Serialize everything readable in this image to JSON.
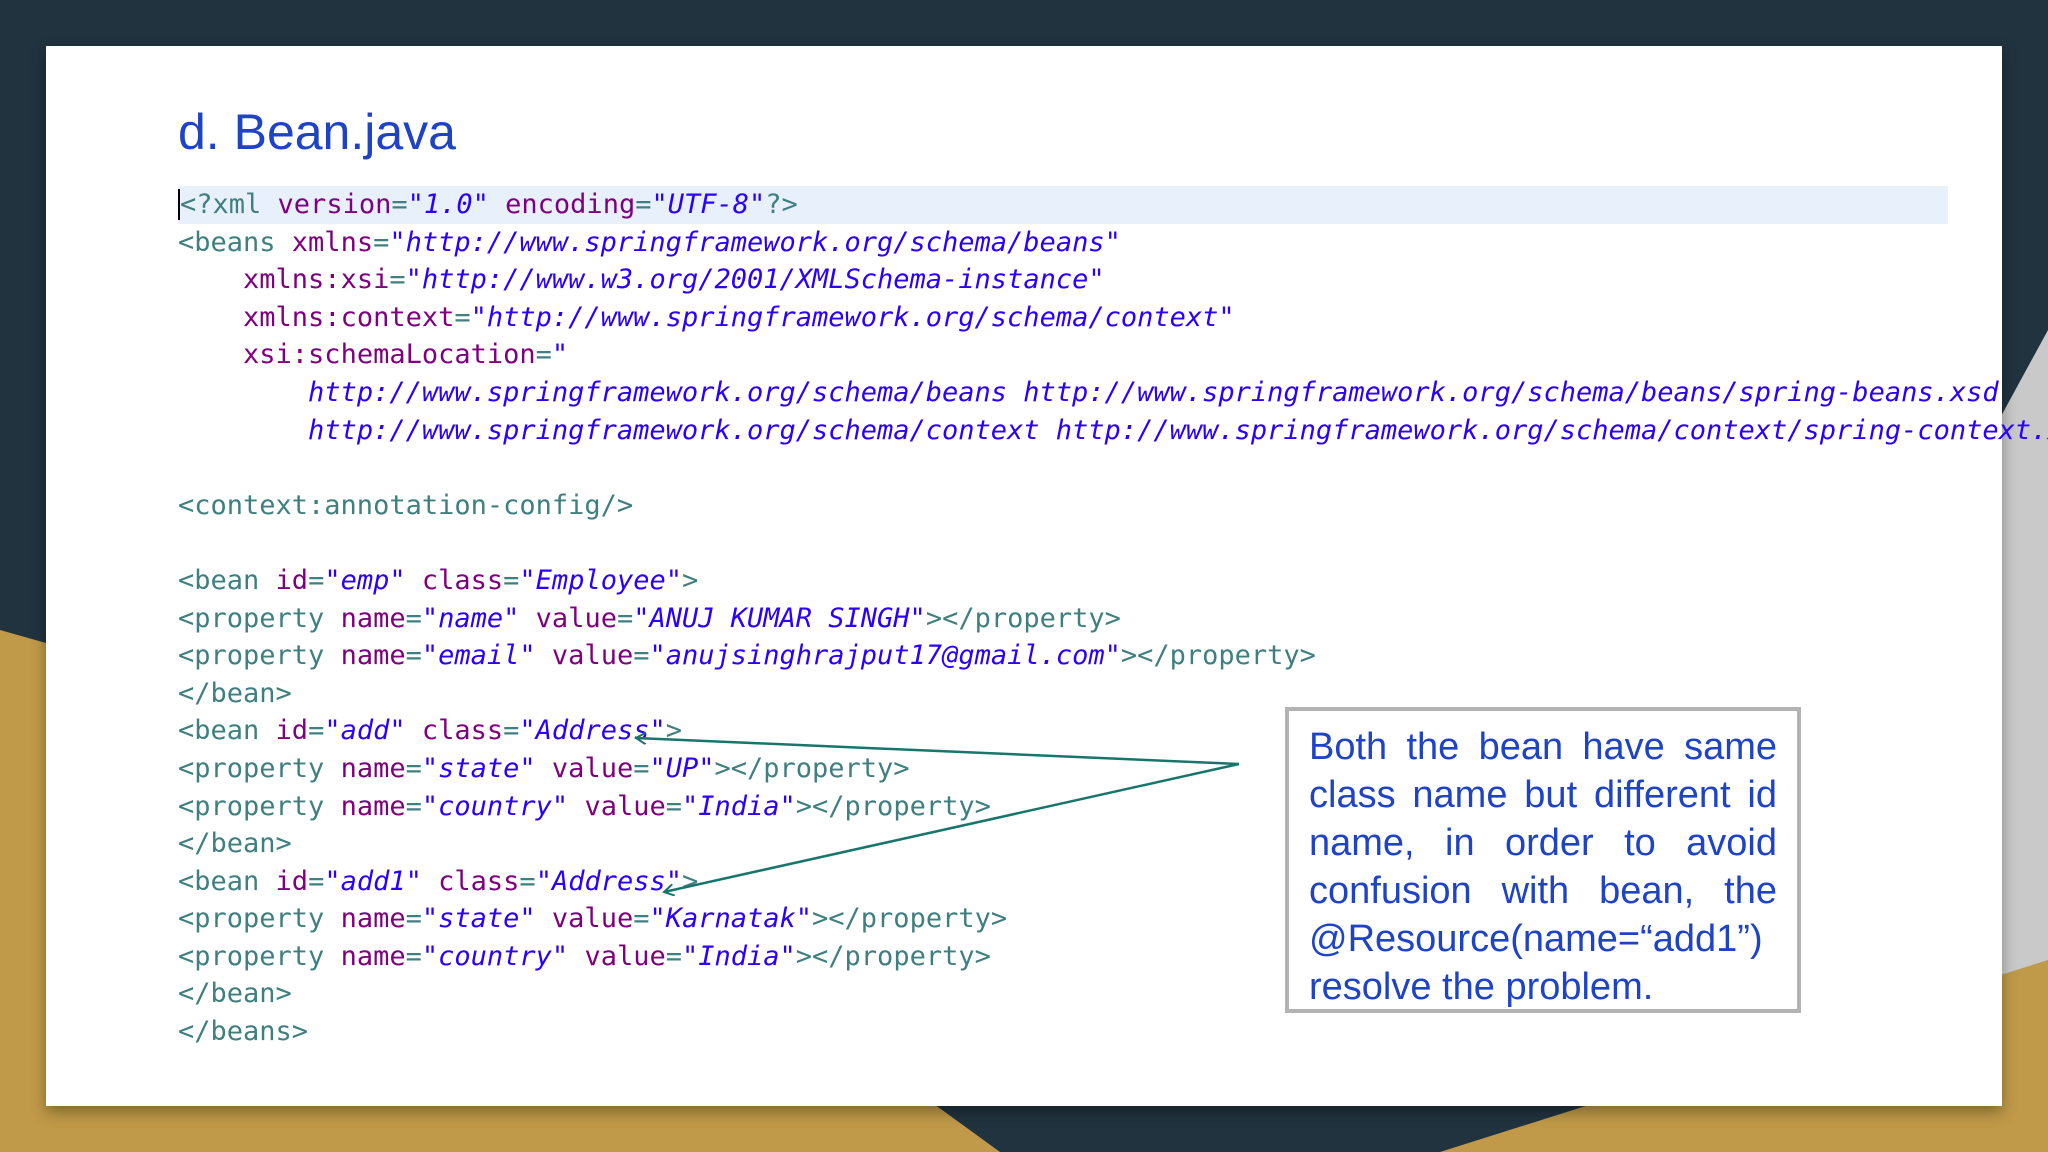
{
  "slide": {
    "title": "d. Bean.java",
    "code_lines": [
      [
        {
          "t": "tag",
          "s": "<?xml "
        },
        {
          "t": "attr",
          "s": "version"
        },
        {
          "t": "tag",
          "s": "="
        },
        {
          "t": "val",
          "s": "\"1.0\""
        },
        {
          "t": "plain",
          "s": " "
        },
        {
          "t": "attr",
          "s": "encoding"
        },
        {
          "t": "tag",
          "s": "="
        },
        {
          "t": "val",
          "s": "\"UTF-8\""
        },
        {
          "t": "tag",
          "s": "?>"
        }
      ],
      [
        {
          "t": "tag",
          "s": "<beans "
        },
        {
          "t": "attr",
          "s": "xmlns"
        },
        {
          "t": "tag",
          "s": "="
        },
        {
          "t": "val",
          "s": "\"http://www.springframework.org/schema/beans\""
        }
      ],
      [
        {
          "t": "plain",
          "s": "    "
        },
        {
          "t": "attr",
          "s": "xmlns:xsi"
        },
        {
          "t": "tag",
          "s": "="
        },
        {
          "t": "val",
          "s": "\"http://www.w3.org/2001/XMLSchema-instance\""
        }
      ],
      [
        {
          "t": "plain",
          "s": "    "
        },
        {
          "t": "attr",
          "s": "xmlns:context"
        },
        {
          "t": "tag",
          "s": "="
        },
        {
          "t": "val",
          "s": "\"http://www.springframework.org/schema/context\""
        }
      ],
      [
        {
          "t": "plain",
          "s": "    "
        },
        {
          "t": "attr",
          "s": "xsi:schemaLocation"
        },
        {
          "t": "tag",
          "s": "="
        },
        {
          "t": "val",
          "s": "\""
        }
      ],
      [
        {
          "t": "plain",
          "s": "        "
        },
        {
          "t": "val",
          "s": "http://www.springframework.org/schema/beans http://www.springframework.org/schema/beans/spring-beans.xsd"
        }
      ],
      [
        {
          "t": "plain",
          "s": "        "
        },
        {
          "t": "val",
          "s": "http://www.springframework.org/schema/context http://www.springframework.org/schema/context/spring-context.xsd\""
        },
        {
          "t": "tag",
          "s": ">"
        }
      ],
      [],
      [
        {
          "t": "tag",
          "s": "<context:annotation-config/>"
        }
      ],
      [],
      [
        {
          "t": "tag",
          "s": "<bean "
        },
        {
          "t": "attr",
          "s": "id"
        },
        {
          "t": "tag",
          "s": "="
        },
        {
          "t": "val",
          "s": "\"emp\""
        },
        {
          "t": "plain",
          "s": " "
        },
        {
          "t": "attr",
          "s": "class"
        },
        {
          "t": "tag",
          "s": "="
        },
        {
          "t": "val",
          "s": "\"Employee\""
        },
        {
          "t": "tag",
          "s": ">"
        }
      ],
      [
        {
          "t": "tag",
          "s": "<property "
        },
        {
          "t": "attr",
          "s": "name"
        },
        {
          "t": "tag",
          "s": "="
        },
        {
          "t": "val",
          "s": "\"name\""
        },
        {
          "t": "plain",
          "s": " "
        },
        {
          "t": "attr",
          "s": "value"
        },
        {
          "t": "tag",
          "s": "="
        },
        {
          "t": "val",
          "s": "\"ANUJ KUMAR SINGH\""
        },
        {
          "t": "tag",
          "s": "></property>"
        }
      ],
      [
        {
          "t": "tag",
          "s": "<property "
        },
        {
          "t": "attr",
          "s": "name"
        },
        {
          "t": "tag",
          "s": "="
        },
        {
          "t": "val",
          "s": "\"email\""
        },
        {
          "t": "plain",
          "s": " "
        },
        {
          "t": "attr",
          "s": "value"
        },
        {
          "t": "tag",
          "s": "="
        },
        {
          "t": "val",
          "s": "\"anujsinghrajput17@gmail.com\""
        },
        {
          "t": "tag",
          "s": "></property>"
        }
      ],
      [
        {
          "t": "tag",
          "s": "</bean>"
        }
      ],
      [
        {
          "t": "tag",
          "s": "<bean "
        },
        {
          "t": "attr",
          "s": "id"
        },
        {
          "t": "tag",
          "s": "="
        },
        {
          "t": "val",
          "s": "\"add\""
        },
        {
          "t": "plain",
          "s": " "
        },
        {
          "t": "attr",
          "s": "class"
        },
        {
          "t": "tag",
          "s": "="
        },
        {
          "t": "val",
          "s": "\"Address\""
        },
        {
          "t": "tag",
          "s": ">"
        }
      ],
      [
        {
          "t": "tag",
          "s": "<property "
        },
        {
          "t": "attr",
          "s": "name"
        },
        {
          "t": "tag",
          "s": "="
        },
        {
          "t": "val",
          "s": "\"state\""
        },
        {
          "t": "plain",
          "s": " "
        },
        {
          "t": "attr",
          "s": "value"
        },
        {
          "t": "tag",
          "s": "="
        },
        {
          "t": "val",
          "s": "\"UP\""
        },
        {
          "t": "tag",
          "s": "></property>"
        }
      ],
      [
        {
          "t": "tag",
          "s": "<property "
        },
        {
          "t": "attr",
          "s": "name"
        },
        {
          "t": "tag",
          "s": "="
        },
        {
          "t": "val",
          "s": "\"country\""
        },
        {
          "t": "plain",
          "s": " "
        },
        {
          "t": "attr",
          "s": "value"
        },
        {
          "t": "tag",
          "s": "="
        },
        {
          "t": "val",
          "s": "\"India\""
        },
        {
          "t": "tag",
          "s": "></property>"
        }
      ],
      [
        {
          "t": "tag",
          "s": "</bean>"
        }
      ],
      [
        {
          "t": "tag",
          "s": "<bean "
        },
        {
          "t": "attr",
          "s": "id"
        },
        {
          "t": "tag",
          "s": "="
        },
        {
          "t": "val",
          "s": "\"add1\""
        },
        {
          "t": "plain",
          "s": " "
        },
        {
          "t": "attr",
          "s": "class"
        },
        {
          "t": "tag",
          "s": "="
        },
        {
          "t": "val",
          "s": "\"Address\""
        },
        {
          "t": "tag",
          "s": ">"
        }
      ],
      [
        {
          "t": "tag",
          "s": "<property "
        },
        {
          "t": "attr",
          "s": "name"
        },
        {
          "t": "tag",
          "s": "="
        },
        {
          "t": "val",
          "s": "\"state\""
        },
        {
          "t": "plain",
          "s": " "
        },
        {
          "t": "attr",
          "s": "value"
        },
        {
          "t": "tag",
          "s": "="
        },
        {
          "t": "val",
          "s": "\"Karnatak\""
        },
        {
          "t": "tag",
          "s": "></property>"
        }
      ],
      [
        {
          "t": "tag",
          "s": "<property "
        },
        {
          "t": "attr",
          "s": "name"
        },
        {
          "t": "tag",
          "s": "="
        },
        {
          "t": "val",
          "s": "\"country\""
        },
        {
          "t": "plain",
          "s": " "
        },
        {
          "t": "attr",
          "s": "value"
        },
        {
          "t": "tag",
          "s": "="
        },
        {
          "t": "val",
          "s": "\"India\""
        },
        {
          "t": "tag",
          "s": "></property>"
        }
      ],
      [
        {
          "t": "tag",
          "s": "</bean>"
        }
      ],
      [
        {
          "t": "tag",
          "s": "</beans>"
        }
      ]
    ],
    "callout_text": "Both the bean have same class name but different id name, in order to avoid confusion with bean, the @Resource(name=“add1”) resolve the problem.",
    "colors": {
      "title": "#1f43c7",
      "tag": "#3f7f7f",
      "attribute": "#7f007f",
      "value": "#2a00ff",
      "arrow": "#17756b",
      "background_dark": "#21333f",
      "background_gold": "#c09a48"
    }
  }
}
